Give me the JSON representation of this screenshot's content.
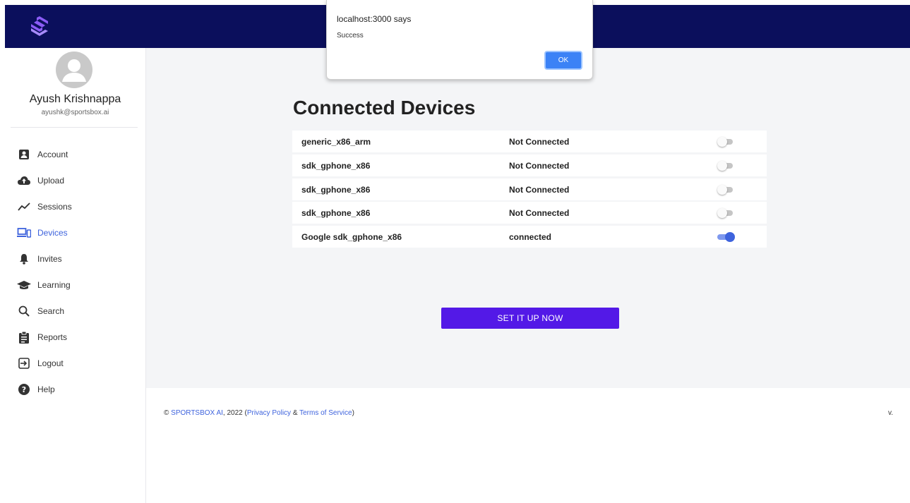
{
  "app": {
    "logo_icon": "sportsbox-logo-icon",
    "topbar_color": "#0b0f5c"
  },
  "user": {
    "name": "Ayush Krishnappa",
    "email": "ayushk@sportsbox.ai",
    "avatar_icon": "user-avatar-icon"
  },
  "nav": [
    {
      "label": "Account",
      "icon": "account-icon",
      "active": false
    },
    {
      "label": "Upload",
      "icon": "cloud-upload-icon",
      "active": false
    },
    {
      "label": "Sessions",
      "icon": "sessions-chart-icon",
      "active": false
    },
    {
      "label": "Devices",
      "icon": "devices-icon",
      "active": true
    },
    {
      "label": "Invites",
      "icon": "bell-icon",
      "active": false
    },
    {
      "label": "Learning",
      "icon": "graduation-cap-icon",
      "active": false
    },
    {
      "label": "Search",
      "icon": "search-icon",
      "active": false
    },
    {
      "label": "Reports",
      "icon": "clipboard-icon",
      "active": false
    },
    {
      "label": "Logout",
      "icon": "logout-icon",
      "active": false
    },
    {
      "label": "Help",
      "icon": "help-icon",
      "active": false
    }
  ],
  "main": {
    "title": "Connected Devices",
    "devices": [
      {
        "name": "generic_x86_arm",
        "status": "Not Connected",
        "connected": false
      },
      {
        "name": "sdk_gphone_x86",
        "status": "Not Connected",
        "connected": false
      },
      {
        "name": "sdk_gphone_x86",
        "status": "Not Connected",
        "connected": false
      },
      {
        "name": "sdk_gphone_x86",
        "status": "Not Connected",
        "connected": false
      },
      {
        "name": "Google sdk_gphone_x86",
        "status": "connected",
        "connected": true
      }
    ],
    "setup_button": "SET IT UP NOW"
  },
  "footer": {
    "copyright_prefix": "© ",
    "company": "SPORTSBOX AI",
    "year_text": ", 2022 (",
    "privacy": "Privacy Policy",
    "amp": " & ",
    "terms": "Terms of Service",
    "close_paren": ")",
    "version": "v."
  },
  "dialog": {
    "title": "localhost:3000 says",
    "message": "Success",
    "ok_label": "OK"
  },
  "colors": {
    "accent": "#3e63dd",
    "button": "#5319e7",
    "background": "#f4f5f7"
  }
}
